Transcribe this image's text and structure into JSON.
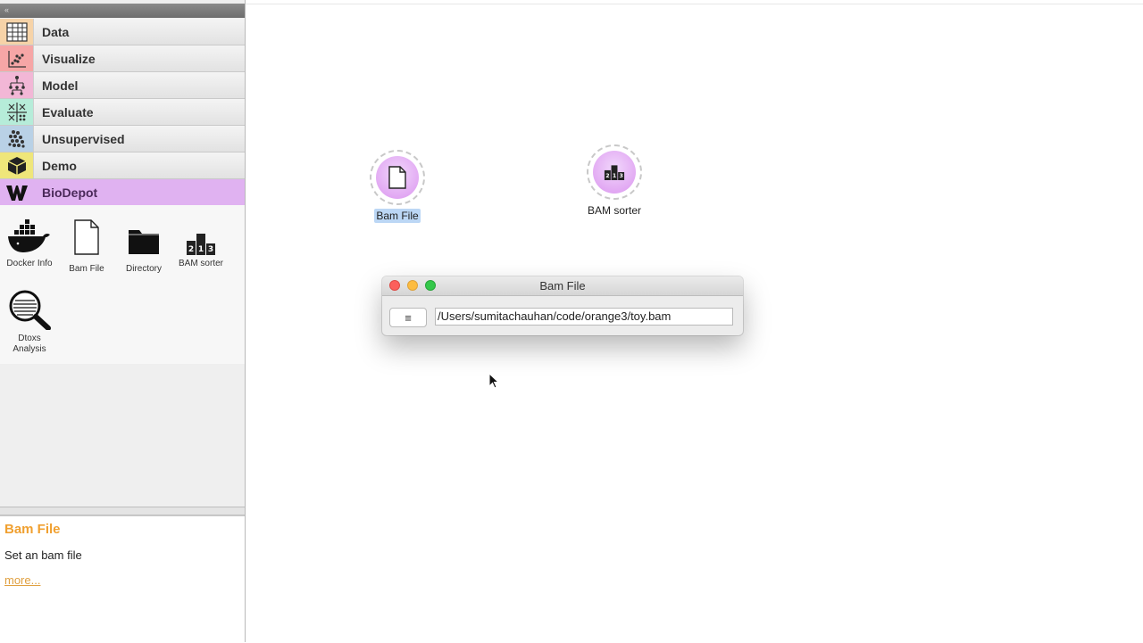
{
  "dock": {
    "collapse_glyph": "«",
    "categories": [
      {
        "label": "Data",
        "icon": "table-icon",
        "color": "#f6d3a8"
      },
      {
        "label": "Visualize",
        "icon": "scatter-plot-icon",
        "color": "#f6a6a6"
      },
      {
        "label": "Model",
        "icon": "tree-model-icon",
        "color": "#f2b7d6"
      },
      {
        "label": "Evaluate",
        "icon": "evaluate-grid-icon",
        "color": "#b6ecd9"
      },
      {
        "label": "Unsupervised",
        "icon": "clusters-icon",
        "color": "#b9d1e6"
      },
      {
        "label": "Demo",
        "icon": "cube-icon",
        "color": "#efe67a"
      },
      {
        "label": "BioDepot",
        "icon": "w-logo-icon",
        "color": "#e0b2f1"
      }
    ],
    "widgets": [
      {
        "label": "Docker Info",
        "icon": "docker-whale-icon"
      },
      {
        "label": "Bam File",
        "icon": "document-icon"
      },
      {
        "label": "Directory",
        "icon": "folder-icon"
      },
      {
        "label": "BAM sorter",
        "icon": "podium-icon"
      },
      {
        "label": "Dtoxs Analysis",
        "icon": "magnifier-icon"
      }
    ],
    "description": {
      "title": "Bam File",
      "text": "Set an bam file",
      "more": "more..."
    }
  },
  "canvas": {
    "nodes": [
      {
        "label": "Bam File",
        "icon": "document-icon",
        "selected": true
      },
      {
        "label": "BAM sorter",
        "icon": "podium-icon",
        "selected": false
      }
    ]
  },
  "dialog": {
    "title": "Bam File",
    "menu_glyph": "≡",
    "path": "/Users/sumitachauhan/code/orange3/toy.bam"
  },
  "colors": {
    "accent_orange": "#f0a030",
    "biodepot_purple": "#e0b2f1",
    "node_purple": "#e2a9f3",
    "selection_blue": "#bcd7f5"
  }
}
